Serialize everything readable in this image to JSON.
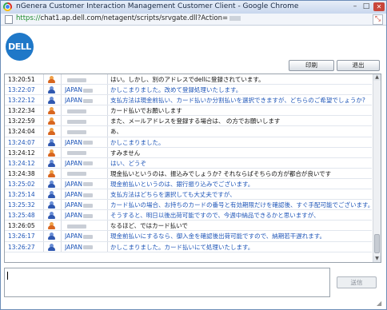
{
  "window": {
    "title": "nGenera Customer Interaction Management Customer Client - Google Chrome",
    "controls": {
      "minimize": "–",
      "maximize": "□",
      "close": "✕"
    }
  },
  "address_bar": {
    "scheme": "https://",
    "url": "chat1.ap.dell.com/netagent/scripts/srvgate.dll?Action="
  },
  "logo": {
    "text": "DELL"
  },
  "toolbar": {
    "print_label": "印刷",
    "exit_label": "退出"
  },
  "chat": {
    "rows": [
      {
        "time": "13:20:51",
        "role": "customer",
        "name": "",
        "message": "はい。しかし、別のアドレスでdellに登録されています。"
      },
      {
        "time": "13:22:07",
        "role": "agent",
        "name": "JAPAN",
        "message": "かしこまりました。改めて登録処理いたします。"
      },
      {
        "time": "13:22:12",
        "role": "agent",
        "name": "JAPAN",
        "message": "支払方法は現金前払い、カード払いか分割払いを選択できますが、どちらのご希望でしょうか?"
      },
      {
        "time": "13:22:34",
        "role": "customer",
        "name": "",
        "message": "カード払いでお願いします"
      },
      {
        "time": "13:22:59",
        "role": "customer",
        "name": "",
        "message": "また、メールアドレスを登録する場合は、                          の方でお願いします"
      },
      {
        "time": "13:24:04",
        "role": "customer",
        "name": "",
        "message": "あ、"
      },
      {
        "time": "13:24:07",
        "role": "agent",
        "name": "JAPAN",
        "message": "かしこまりました。"
      },
      {
        "time": "13:24:12",
        "role": "customer",
        "name": "",
        "message": "すみません"
      },
      {
        "time": "13:24:12",
        "role": "agent",
        "name": "JAPAN",
        "message": "はい、どうぞ"
      },
      {
        "time": "13:24:38",
        "role": "customer",
        "name": "",
        "message": "現金払いというのは、振込みでしょうか? それならばそちらの方が都合が良いです"
      },
      {
        "time": "13:25:02",
        "role": "agent",
        "name": "JAPAN",
        "message": "現金前払いというのは、銀行振り込みでございます。"
      },
      {
        "time": "13:25:14",
        "role": "agent",
        "name": "JAPAN",
        "message": "支払方法はどちらを選択しても大丈夫ですが、"
      },
      {
        "time": "13:25:32",
        "role": "agent",
        "name": "JAPAN",
        "message": "カード払いの場合、お持ちのカードの番号と有効期限だけを確認後、すぐ手配可能でございます。"
      },
      {
        "time": "13:25:48",
        "role": "agent",
        "name": "JAPAN",
        "message": "そうすると、明日以後出荷可能ですので、今週中納品できるかと思いますが、"
      },
      {
        "time": "13:26:05",
        "role": "customer",
        "name": "",
        "message": "なるほど、ではカード払いで"
      },
      {
        "time": "13:26:17",
        "role": "agent",
        "name": "JAPAN",
        "message": "現金前払いにするなら、御入金を確認後出荷可能ですので、納期若干遅れます。"
      },
      {
        "time": "13:26:27",
        "role": "agent",
        "name": "JAPAN",
        "message": "かしこまりました。カード払いにて処理いたします。"
      }
    ]
  },
  "input": {
    "value": ""
  },
  "send_label": "送信",
  "colors": {
    "agent_text": "#1f56b8",
    "customer_text": "#111111",
    "customer_icon": "#d8661f",
    "agent_icon": "#2f58b0",
    "logo": "#1f78c8"
  },
  "icons": {
    "customer": "customer-icon",
    "agent": "agent-icon",
    "browser": "chrome-icon",
    "page": "page-icon"
  }
}
